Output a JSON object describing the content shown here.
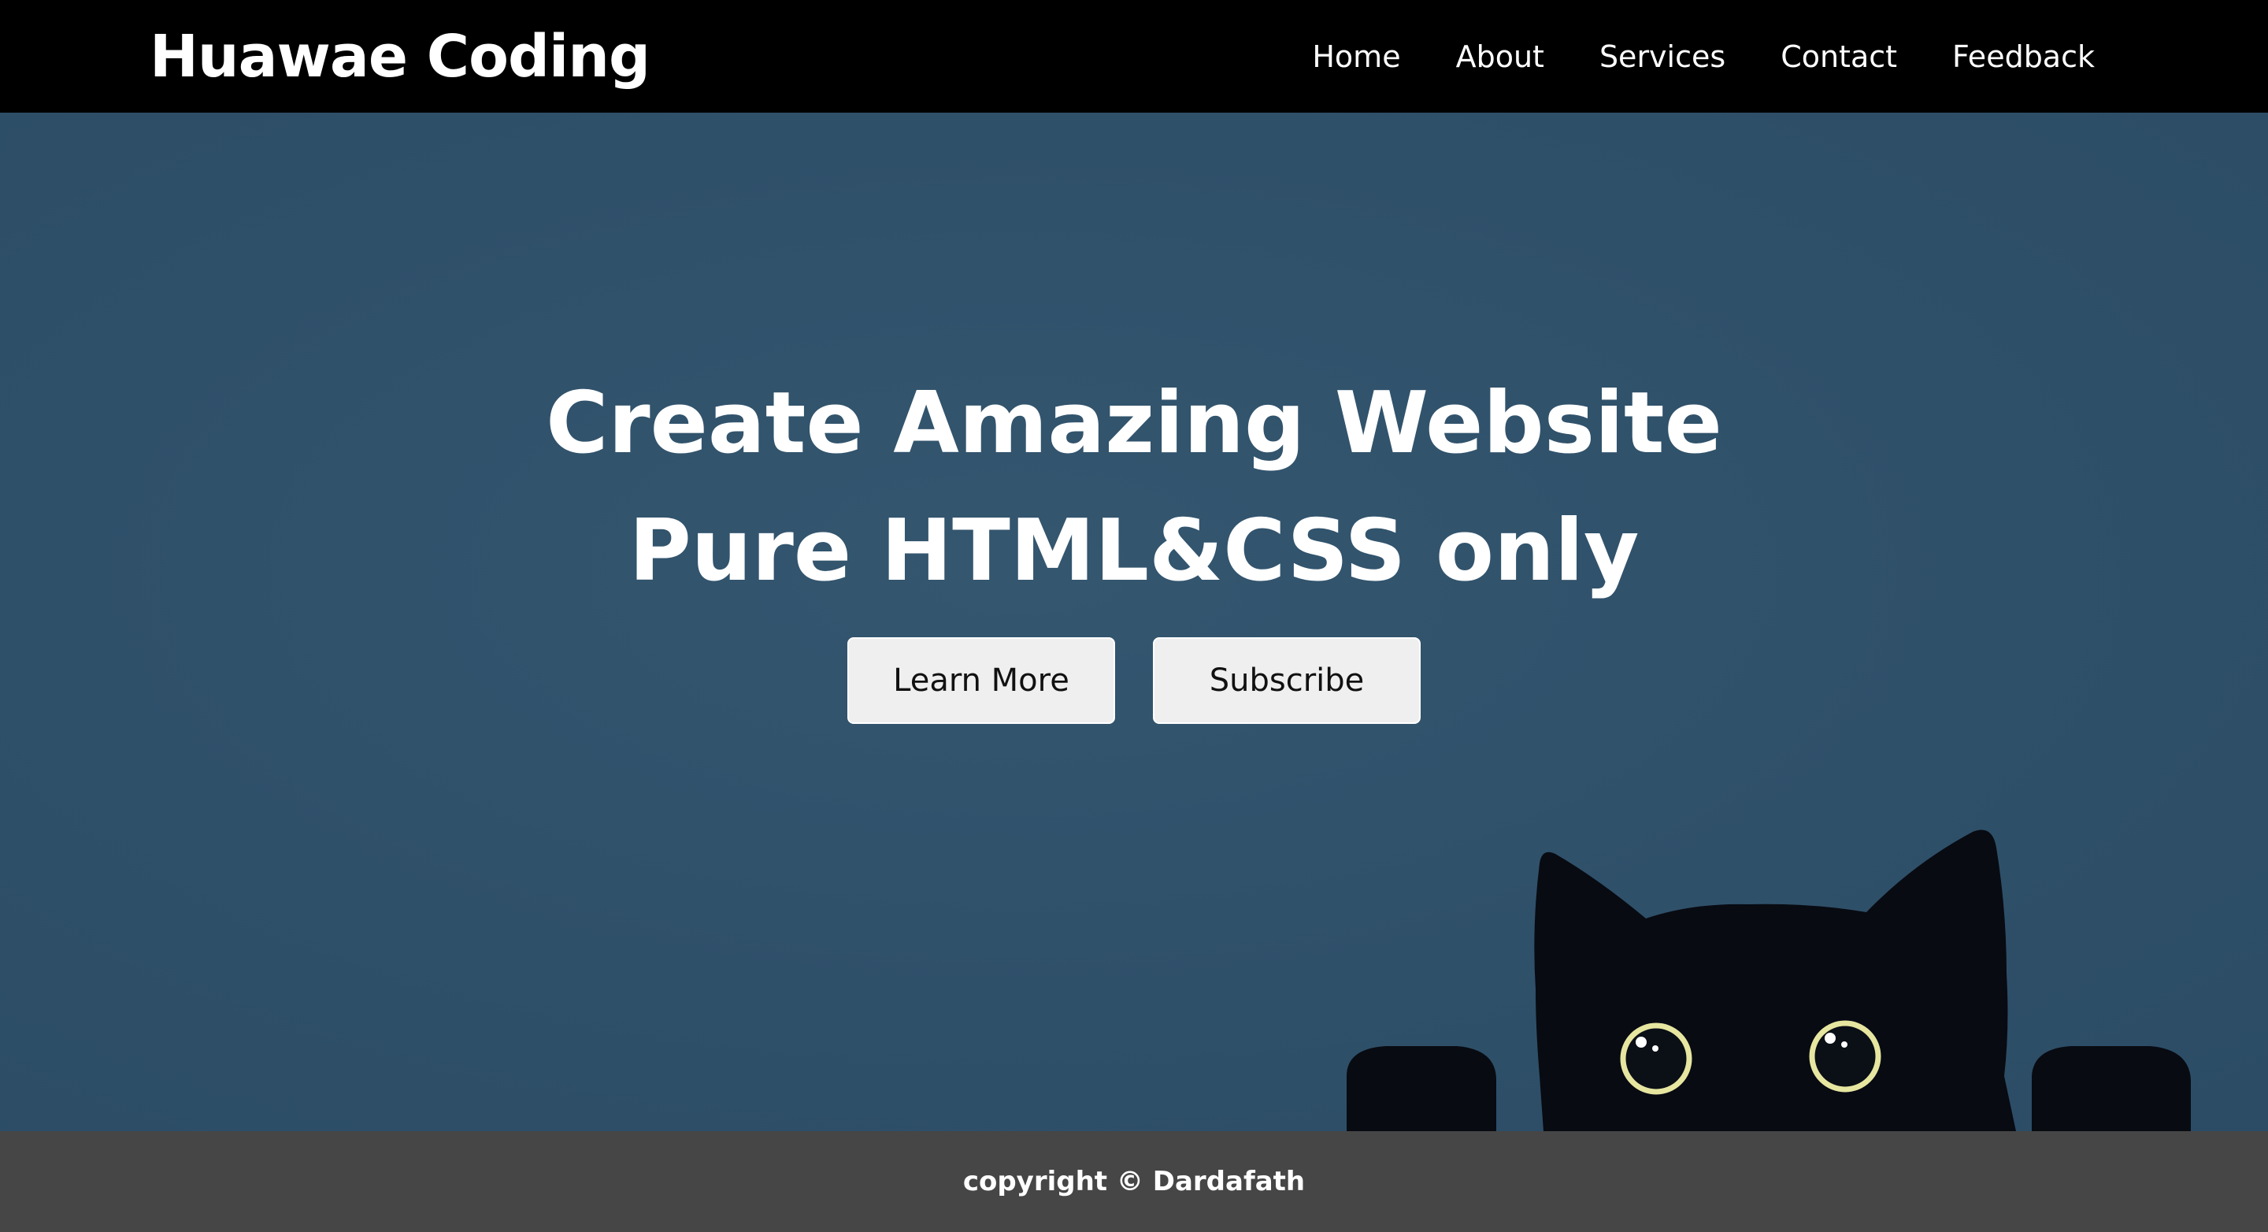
{
  "brand": {
    "name": "Huawae Coding"
  },
  "nav": {
    "items": [
      {
        "label": "Home"
      },
      {
        "label": "About"
      },
      {
        "label": "Services"
      },
      {
        "label": "Contact"
      },
      {
        "label": "Feedback"
      }
    ]
  },
  "hero": {
    "title_line1": "Create Amazing Website",
    "title_line2": "Pure HTML&CSS only",
    "buttons": {
      "learn_more": "Learn More",
      "subscribe": "Subscribe"
    },
    "illustration": "black-cat-peeking"
  },
  "footer": {
    "copyright": "copyright © Dardafath"
  },
  "colors": {
    "navbar_bg": "#000000",
    "hero_bg": "#2f4f69",
    "footer_bg": "#464646",
    "button_bg": "#efefef",
    "cat_eye": "#e6e6a0"
  }
}
